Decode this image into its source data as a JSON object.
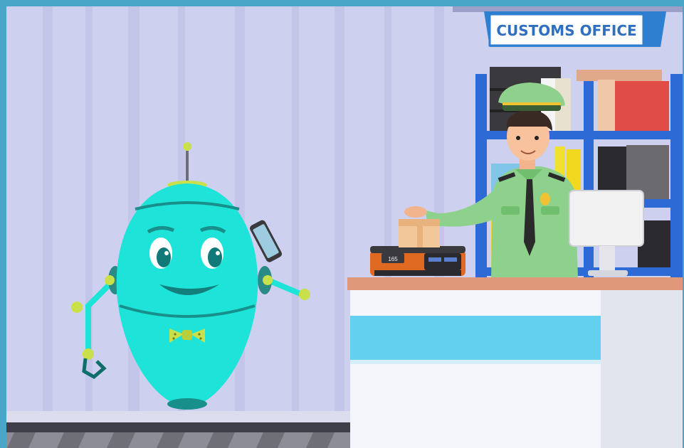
{
  "sign": {
    "text": "CUSTOMS OFFICE"
  },
  "scale": {
    "display": "165"
  },
  "colors": {
    "wall": "#cdd0ee",
    "robot_body": "#1ee3d8",
    "robot_accent": "#c9e04a",
    "officer_uniform": "#8ed18c",
    "counter_stripe": "#64d0ef",
    "counter_top": "#e0987a"
  },
  "icons": {
    "robot": "robot-character",
    "officer": "customs-officer-character",
    "phone": "phone-icon",
    "package": "package-icon",
    "scale": "weighing-scale-icon",
    "monitor": "monitor-icon"
  }
}
